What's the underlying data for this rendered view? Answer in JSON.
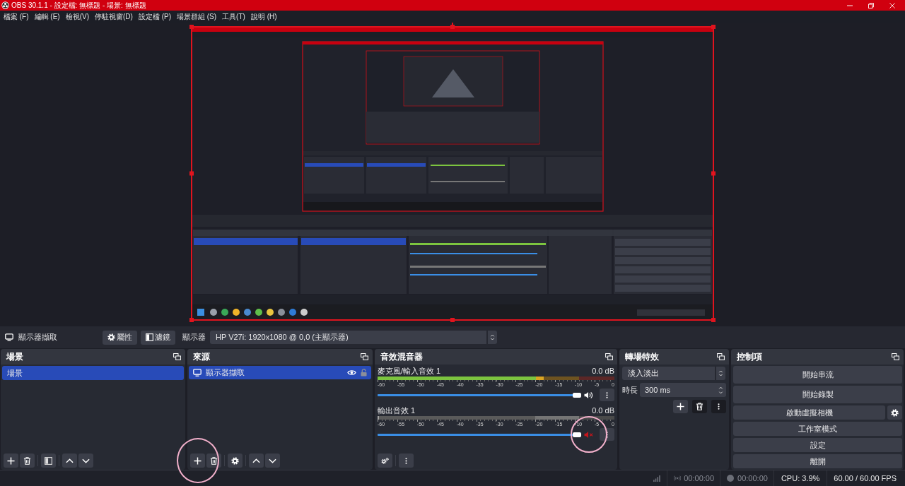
{
  "window": {
    "title": "OBS 30.1.1 - 設定檔: 無標題 - 場景: 無標題"
  },
  "menu": [
    "檔案 (F)",
    "編輯 (E)",
    "檢視(V)",
    "停駐視窗(D)",
    "設定檔 (P)",
    "場景群組 (S)",
    "工具(T)",
    "說明 (H)"
  ],
  "source_toolbar": {
    "source_name": "顯示器擷取",
    "properties_button": "屬性",
    "filters_button": "濾鏡",
    "display_label": "顯示器",
    "display_value": "HP V27i: 1920x1080 @ 0,0 (主顯示器)"
  },
  "scenes": {
    "title": "場景",
    "items": [
      {
        "name": "場景",
        "selected": true
      }
    ]
  },
  "sources": {
    "title": "來源",
    "items": [
      {
        "name": "顯示器擷取",
        "selected": true,
        "visible": true,
        "locked": false
      }
    ],
    "add_button_circled": true
  },
  "mixer": {
    "title": "音效混音器",
    "channels": [
      {
        "name": "麥克風/輸入音效 1",
        "reading": "0.0 dB",
        "muted": false,
        "mute_circled": false,
        "meter": {
          "level": 0.7
        },
        "volume": {
          "level": 1
        },
        "scale": [
          "-60",
          "-55",
          "-50",
          "-45",
          "-40",
          "-35",
          "-30",
          "-25",
          "-20",
          "-15",
          "-10",
          "-5",
          "0"
        ]
      },
      {
        "name": "輸出音效 1",
        "reading": "0.0 dB",
        "muted": true,
        "mute_circled": true,
        "meter": {
          "level": 0
        },
        "volume": {
          "level": 1
        },
        "scale": [
          "-60",
          "-55",
          "-50",
          "-45",
          "-40",
          "-35",
          "-30",
          "-25",
          "-20",
          "-15",
          "-10",
          "-5",
          "0"
        ]
      }
    ]
  },
  "transitions": {
    "title": "轉場特效",
    "transition": "淡入淡出",
    "duration_label": "時長",
    "duration": "300 ms"
  },
  "controls": {
    "title": "控制項",
    "buttons": [
      {
        "label": "開始串流",
        "kind": "large"
      },
      {
        "label": "開始錄製",
        "kind": "large"
      },
      {
        "label": "啟動虛擬相機",
        "kind": "with-settings"
      },
      {
        "label": "工作室模式",
        "kind": "normal"
      },
      {
        "label": "設定",
        "kind": "normal"
      },
      {
        "label": "離開",
        "kind": "normal"
      }
    ]
  },
  "status_bar": {
    "stream_time": "00:00:00",
    "record_time": "00:00:00",
    "cpu": "CPU: 3.9%",
    "fps": "60.00 / 60.00 FPS"
  }
}
